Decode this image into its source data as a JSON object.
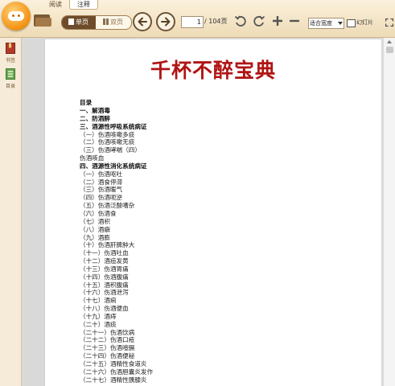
{
  "app": {
    "tabs": [
      "阅读",
      "注释"
    ],
    "active_tab": "注释"
  },
  "toolbar": {
    "single_page_label": "单页",
    "double_page_label": "双页",
    "current_page": "1",
    "total_pages": "/ 104页",
    "fit_mode": "适合宽度",
    "slideshow_label": "幻灯片"
  },
  "sidebar": {
    "items": [
      {
        "label": "书签",
        "icon": "bookmark-icon"
      },
      {
        "label": "目录",
        "icon": "toc-icon"
      }
    ]
  },
  "document": {
    "title": "千杯不醉宝典",
    "toc_heading": "目录",
    "toc": [
      {
        "text": "一、解酒毒",
        "type": "sec"
      },
      {
        "text": "二、防酒醉",
        "type": "sec"
      },
      {
        "text": "三、酒源性呼吸系统病证",
        "type": "sec"
      },
      {
        "text": "（一）伤酒咳嗽多痰",
        "type": "item"
      },
      {
        "text": "（二）伤酒咳嗽无痰",
        "type": "item"
      },
      {
        "text": "（三）伤酒哮喘（四）",
        "type": "item"
      },
      {
        "text": "伤酒咳血",
        "type": "item"
      },
      {
        "text": "四、酒源性消化系统病证",
        "type": "sec"
      },
      {
        "text": "（一）伤酒呕吐",
        "type": "item"
      },
      {
        "text": "（二）酒食停滞",
        "type": "item"
      },
      {
        "text": "（三）伤酒暖气",
        "type": "item"
      },
      {
        "text": "（四）伤酒呃逆",
        "type": "item"
      },
      {
        "text": "（五）伤酒泛酸嘈杂",
        "type": "item"
      },
      {
        "text": "（六）伤酒食",
        "type": "item"
      },
      {
        "text": "（七）酒积",
        "type": "item"
      },
      {
        "text": "（八）酒癖",
        "type": "item"
      },
      {
        "text": "（九）酒膨",
        "type": "item"
      },
      {
        "text": "（十）伤酒肝脾肿大",
        "type": "item"
      },
      {
        "text": "（十一）伤酒吐血",
        "type": "item"
      },
      {
        "text": "（十二）酒疸发黄",
        "type": "item"
      },
      {
        "text": "（十三）伤酒胃痛",
        "type": "item"
      },
      {
        "text": "（十四）伤酒腹痛",
        "type": "item"
      },
      {
        "text": "（十五）酒积腹痛",
        "type": "item"
      },
      {
        "text": "（十六）伤酒泄泻",
        "type": "item"
      },
      {
        "text": "（十七）酒痢",
        "type": "item"
      },
      {
        "text": "（十八）伤酒便血",
        "type": "item"
      },
      {
        "text": "（十九）酒痔",
        "type": "item"
      },
      {
        "text": "（二十）酒痰",
        "type": "item"
      },
      {
        "text": "（二十一）伤酒饮病",
        "type": "item"
      },
      {
        "text": "（二十二）伤酒口疮",
        "type": "item"
      },
      {
        "text": "（二十三）伤酒噎膈",
        "type": "item"
      },
      {
        "text": "（二十四）伤酒便秘",
        "type": "item"
      },
      {
        "text": "（二十五）酒精性食道炎",
        "type": "item"
      },
      {
        "text": "（二十六）伤酒胆囊炎发作",
        "type": "item"
      },
      {
        "text": "（二十七）酒精性胰腺炎",
        "type": "item"
      }
    ]
  }
}
